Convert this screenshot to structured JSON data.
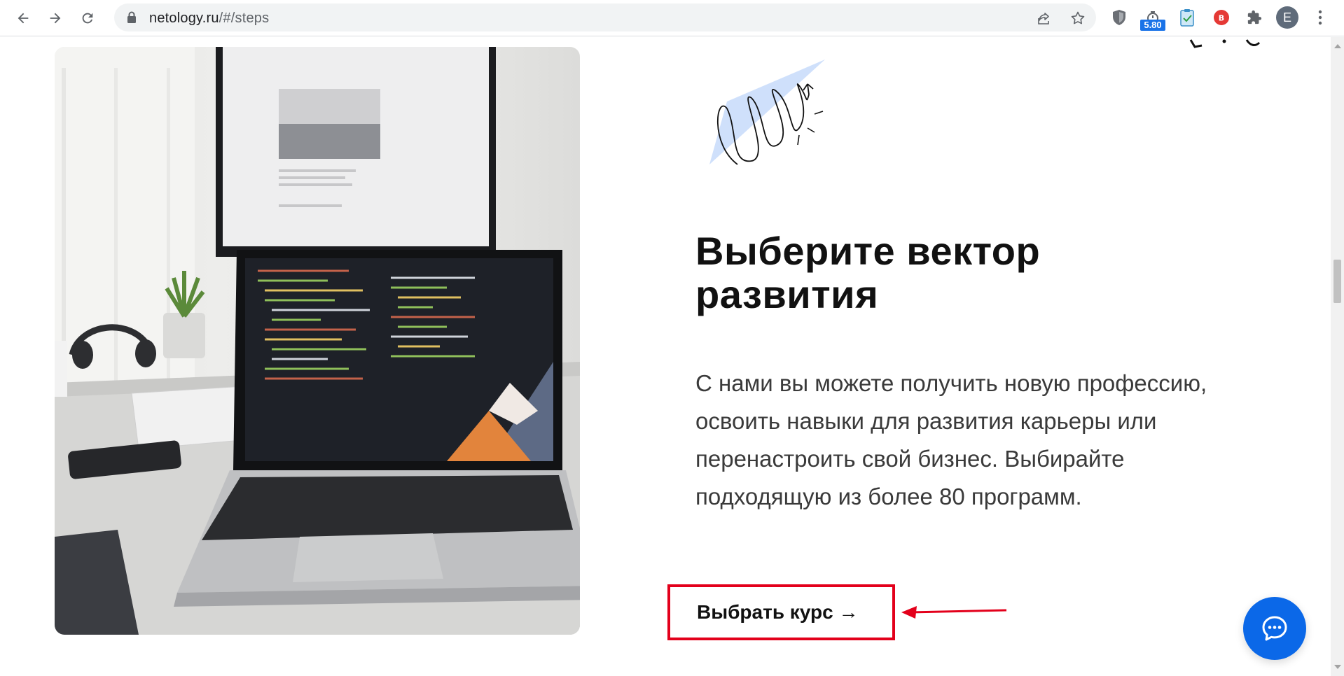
{
  "browser": {
    "url_host": "netology.ru",
    "url_path": "/#/steps",
    "extension_badge": "5.80",
    "profile_initial": "E"
  },
  "page": {
    "headline": "Выберите вектор развития",
    "body": "С нами вы можете получить новую профессию, освоить навыки для развития карьеры или перенастроить свой бизнес. Выбирайте подходящую из более 80 программ.",
    "cta_label": "Выбрать курс →"
  },
  "colors": {
    "accent_blue": "#0b68e8",
    "annotation_red": "#e3001b",
    "deco_blue": "#cfe0fb"
  }
}
